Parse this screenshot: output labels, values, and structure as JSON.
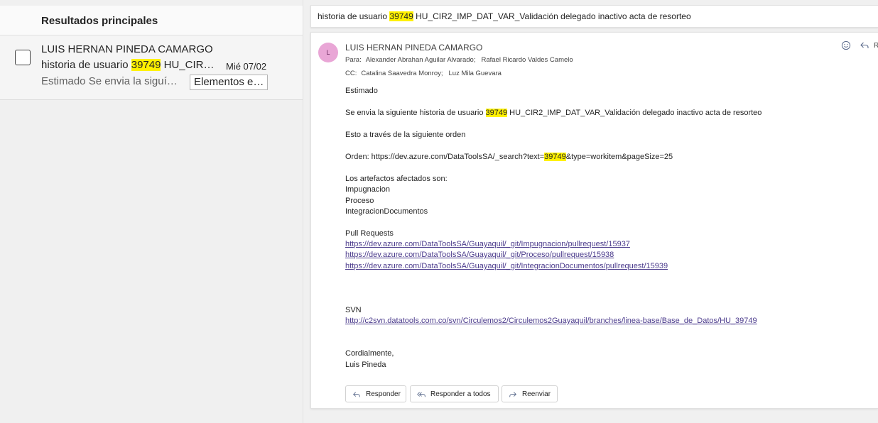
{
  "search": {
    "results_header": "Resultados principales",
    "highlight_term": "39749"
  },
  "result": {
    "sender": "LUIS HERNAN PINEDA CAMARGO",
    "subject_before": "historia de usuario ",
    "subject_highlight": "39749",
    "subject_after": " HU_CIR…",
    "date": "Mié 07/02",
    "preview": "Estimado Se envia la siguí…",
    "folder_tag": "Elementos e…"
  },
  "message": {
    "subject_before": "historia de usuario ",
    "subject_highlight": "39749",
    "subject_after": " HU_CIR2_IMP_DAT_VAR_Validación delegado inactivo acta de resorteo",
    "avatar_initial": "L",
    "from": "LUIS HERNAN PINEDA CAMARGO",
    "to_label": "Para:",
    "to": [
      "Alexander Abrahan Aguilar Alvarado;",
      "Rafael Ricardo Valdes Camelo"
    ],
    "cc_label": "CC:",
    "cc": [
      "Catalina Saavedra Monroy;",
      "Luz Mila Guevara"
    ],
    "reply_top_label": "R",
    "body": {
      "greeting": "Estimado",
      "p1_before": "Se envia la siguiente historia de usuario ",
      "p1_highlight": "39749",
      "p1_after": " HU_CIR2_IMP_DAT_VAR_Validación delegado inactivo acta de resorteo",
      "p2": "Esto a través de la siguiente orden",
      "order_before": "Orden: https://dev.azure.com/DataToolsSA/_search?text=",
      "order_highlight": "39749",
      "order_after": "&type=workitem&pageSize=25",
      "artifacts_title": "Los artefactos afectados son:",
      "artifacts": [
        "Impugnacion",
        "Proceso",
        "IntegracionDocumentos"
      ],
      "pr_title": "Pull Requests",
      "pr_links": [
        "https://dev.azure.com/DataToolsSA/Guayaquil/_git/Impugnacion/pullrequest/15937",
        "https://dev.azure.com/DataToolsSA/Guayaquil/_git/Proceso/pullrequest/15938",
        "https://dev.azure.com/DataToolsSA/Guayaquil/_git/IntegracionDocumentos/pullrequest/15939"
      ],
      "svn_title": "SVN",
      "svn_link": "http://c2svn.datatools.com.co/svn/Circulemos2/Circulemos2Guayaquil/branches/linea-base/Base_de_Datos/HU_39749",
      "closing": "Cordialmente,",
      "signature": "Luis Pineda"
    },
    "actions": {
      "reply": "Responder",
      "reply_all": "Responder a todos",
      "forward": "Reenviar"
    }
  },
  "colors": {
    "highlight": "#fff100",
    "avatar_bg": "#e9a6d6",
    "link": "#4b3b8c",
    "pane_bg": "#f0f0f0"
  }
}
